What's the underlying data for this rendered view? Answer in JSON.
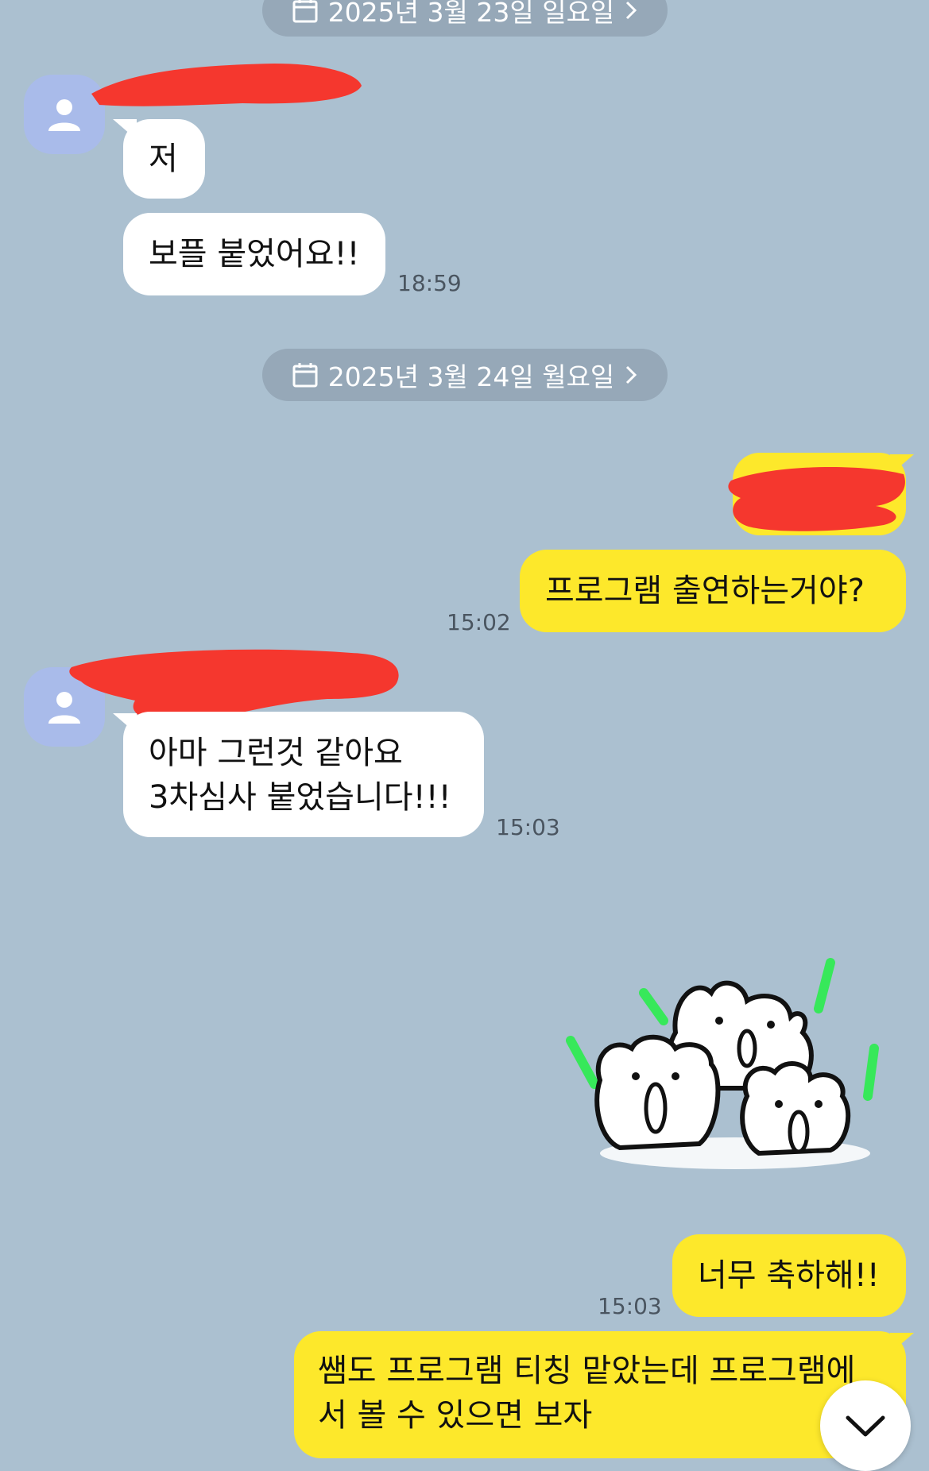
{
  "dates": [
    {
      "label": "2025년 3월 23일 일요일"
    },
    {
      "label": "2025년 3월 24일 월요일"
    }
  ],
  "messages": [
    {
      "text": "저"
    },
    {
      "text": "보플 붙었어요!!",
      "time": "18:59"
    },
    {
      "text": "프로그램 출연하는거야?",
      "time": "15:02"
    },
    {
      "lines": [
        "아마 그런것 같아요",
        "3차심사 붙었습니다!!!"
      ],
      "time": "15:03"
    },
    {
      "sticker": "cheering-creatures-sticker",
      "time": "15:03"
    },
    {
      "text": "너무 축하해!!",
      "time": "15:03"
    },
    {
      "lines": [
        "쌤도 프로그램 티칭 맡았는데 프로그램에",
        "서 볼 수 있으면 보자"
      ]
    }
  ],
  "colors": {
    "background": "#abc0d0",
    "incoming_bubble": "#ffffff",
    "outgoing_bubble": "#fde82b",
    "date_pill": "#96a8b8",
    "avatar": "#a9bbea",
    "redaction": "#f5372e"
  },
  "icons": {
    "calendar": "calendar-icon",
    "chevron": "chevron-right-icon",
    "avatar": "person-icon",
    "scroll": "chevron-down-icon"
  }
}
